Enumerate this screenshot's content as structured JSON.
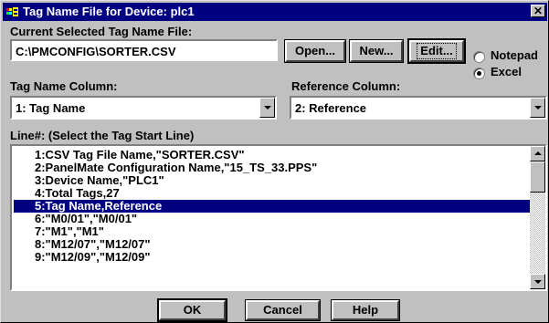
{
  "window": {
    "title": "Tag Name File for Device: plc1",
    "close_glyph": "✕"
  },
  "current_file": {
    "label": "Current Selected Tag Name File:",
    "value": "C:\\PMCONFIG\\SORTER.CSV"
  },
  "buttons": {
    "open": "Open...",
    "new": "New...",
    "edit": "Edit...",
    "ok": "OK",
    "cancel": "Cancel",
    "help": "Help"
  },
  "editor_options": [
    {
      "label": "Notepad",
      "selected": false
    },
    {
      "label": "Excel",
      "selected": true
    }
  ],
  "tag_name_column": {
    "label": "Tag Name Column:",
    "value": "1: Tag Name"
  },
  "reference_column": {
    "label": "Reference Column:",
    "value": "2: Reference"
  },
  "lines": {
    "label": "Line#: (Select the Tag Start Line)",
    "selected_index": 4,
    "items": [
      "1:CSV Tag File Name,\"SORTER.CSV\"",
      "2:PanelMate Configuration Name,\"15_TS_33.PPS\"",
      "3:Device Name,\"PLC1\"",
      "4:Total Tags,27",
      "5:Tag Name,Reference",
      "6:\"M0/01\",\"M0/01\"",
      "7:\"M1\",\"M1\"",
      "8:\"M12/07\",\"M12/07\"",
      "9:\"M12/09\",\"M12/09\""
    ]
  },
  "icons": {
    "app": "app-icon",
    "close": "close-icon",
    "combo": "chevron-down-icon",
    "scroll_up": "scroll-up-icon",
    "scroll_down": "scroll-down-icon"
  },
  "colors": {
    "titlebar": "#000080",
    "selection": "#000080",
    "face": "#c0c0c0"
  }
}
